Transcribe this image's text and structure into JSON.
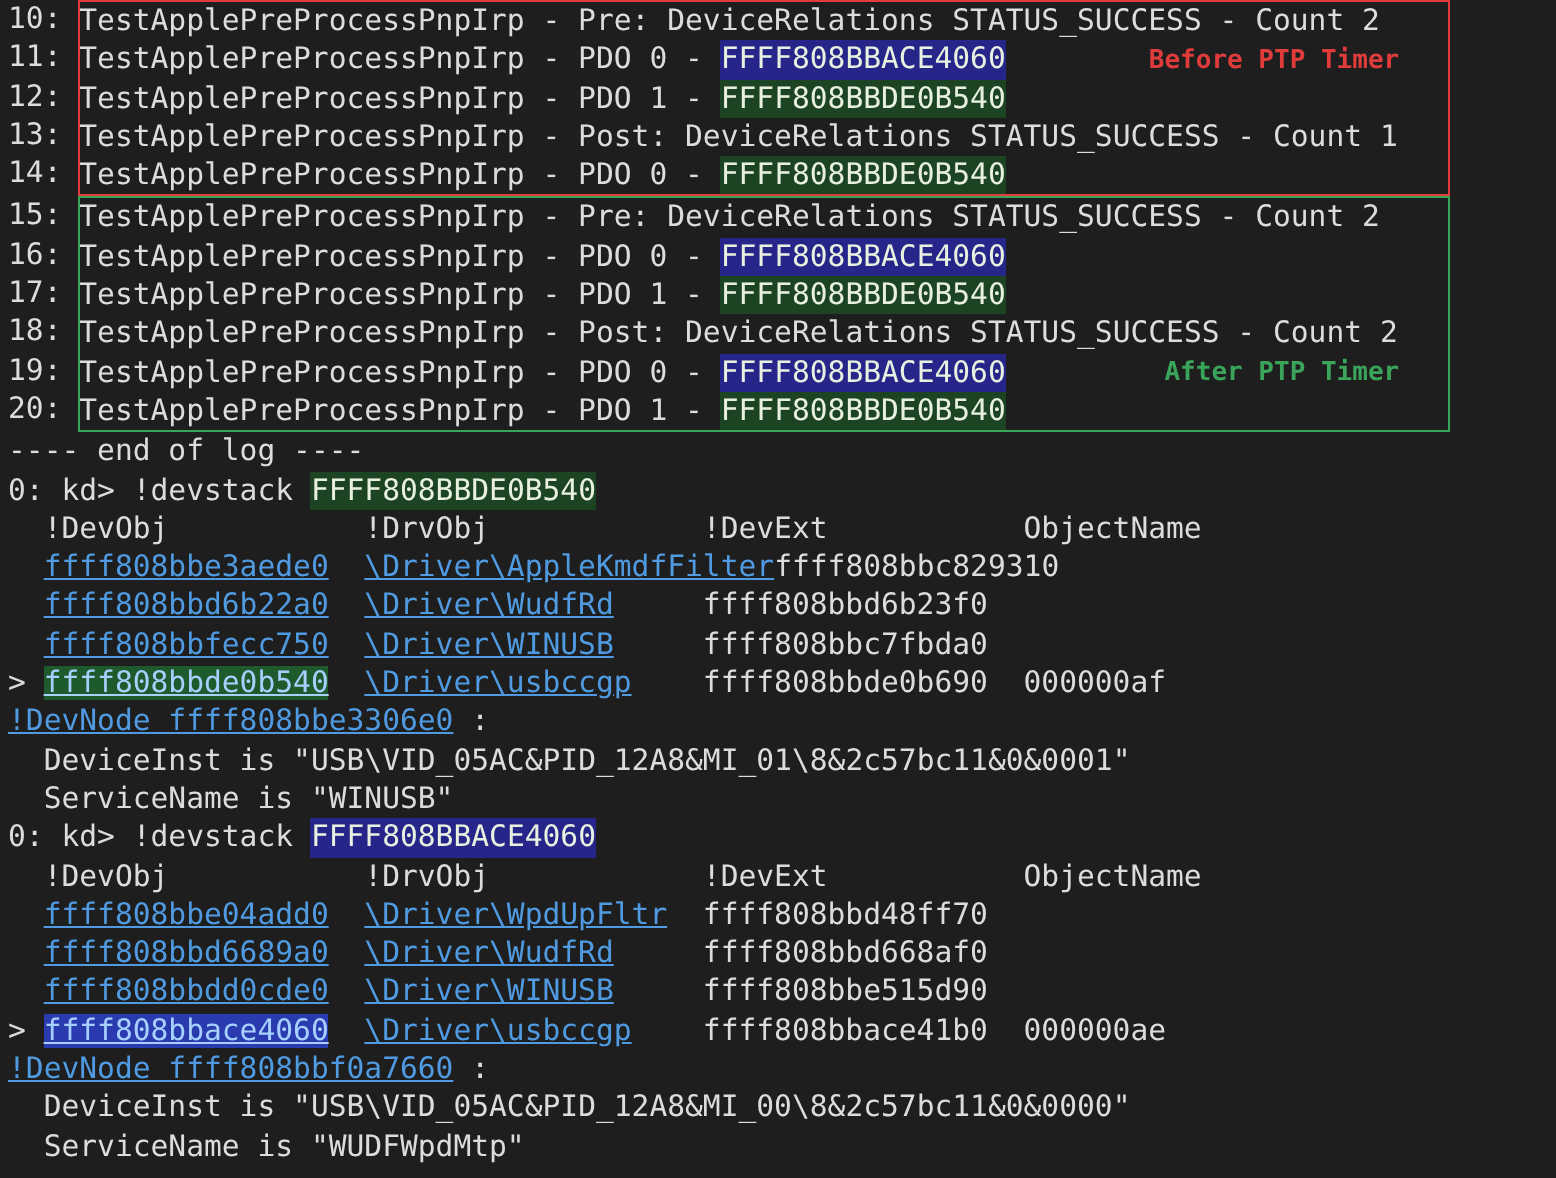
{
  "log_groups": [
    {
      "kind": "before",
      "label": "Before PTP Timer",
      "color": "#e03c3c",
      "lines": [
        {
          "number": "10:",
          "text": "TestApplePreProcessPnpIrp - Pre: DeviceRelations STATUS_SUCCESS - Count 2"
        },
        {
          "number": "11:",
          "text": "TestApplePreProcessPnpIrp - PDO 0 - ",
          "value": "FFFF808BBACE4060",
          "color": "#25258a"
        },
        {
          "number": "12:",
          "text": "TestApplePreProcessPnpIrp - PDO 1 - ",
          "value": "FFFF808BBDE0B540",
          "color": "#1c4422"
        },
        {
          "number": "13:",
          "text": "TestApplePreProcessPnpIrp - Post: DeviceRelations STATUS_SUCCESS - Count 1"
        },
        {
          "number": "14:",
          "text": "TestApplePreProcessPnpIrp - PDO 0 - ",
          "value": "FFFF808BBDE0B540",
          "color": "#1c4422"
        }
      ]
    },
    {
      "kind": "after",
      "label": "After PTP Timer",
      "color": "#3aa55a",
      "lines": [
        {
          "number": "15:",
          "text": "TestApplePreProcessPnpIrp - Pre: DeviceRelations STATUS_SUCCESS - Count 2"
        },
        {
          "number": "16:",
          "text": "TestApplePreProcessPnpIrp - PDO 0 - ",
          "value": "FFFF808BBACE4060",
          "color": "#25258a"
        },
        {
          "number": "17:",
          "text": "TestApplePreProcessPnpIrp - PDO 1 - ",
          "value": "FFFF808BBDE0B540",
          "color": "#1c4422"
        },
        {
          "number": "18:",
          "text": "TestApplePreProcessPnpIrp - Post: DeviceRelations STATUS_SUCCESS - Count 2"
        },
        {
          "number": "19:",
          "text": "TestApplePreProcessPnpIrp - PDO 0 - ",
          "value": "FFFF808BBACE4060",
          "color": "#25258a"
        },
        {
          "number": "20:",
          "text": "TestApplePreProcessPnpIrp - PDO 1 - ",
          "value": "FFFF808BBDE0B540",
          "color": "#1c4422"
        }
      ]
    }
  ],
  "end_of_log": "---- end of log ----",
  "devstacks": [
    {
      "prompt": "0: kd> !devstack",
      "address": "FFFF808BBDE0B540",
      "color": "#1c4422",
      "columns": [
        "!DevObj",
        "!DrvObj",
        "!DevExt",
        "ObjectName"
      ],
      "rows": [
        {
          "selected": false,
          "devobj": "ffff808bbe3aede0",
          "drvobj": "\\Driver\\AppleKmdfFilter",
          "devext": "ffff808bbc829310"
        },
        {
          "selected": false,
          "devobj": "ffff808bbd6b22a0",
          "drvobj": "\\Driver\\WudfRd",
          "devext": "ffff808bbd6b23f0"
        },
        {
          "selected": false,
          "devobj": "ffff808bbfecc750",
          "drvobj": "\\Driver\\WINUSB",
          "devext": "ffff808bbc7fbda0"
        },
        {
          "selected": true,
          "marker": ">",
          "color": "#1d5a2c",
          "devobj": "ffff808bbde0b540",
          "drvobj": "\\Driver\\usbccgp",
          "devext": "ffff808bbde0b690",
          "object_name": "000000af"
        }
      ],
      "devnode_link": "!DevNode ffff808bbe3306e0",
      "devnode_suffix": ":",
      "details": [
        "DeviceInst is \"USB\\VID_05AC&PID_12A8&MI_01\\8&2c57bc11&0&0001\"",
        "ServiceName is \"WINUSB\""
      ]
    },
    {
      "prompt": "0: kd> !devstack",
      "address": "FFFF808BBACE4060",
      "color": "#25258a",
      "columns": [
        "!DevObj",
        "!DrvObj",
        "!DevExt",
        "ObjectName"
      ],
      "rows": [
        {
          "selected": false,
          "devobj": "ffff808bbe04add0",
          "drvobj": "\\Driver\\WpdUpFltr",
          "devext": "ffff808bbd48ff70"
        },
        {
          "selected": false,
          "devobj": "ffff808bbd6689a0",
          "drvobj": "\\Driver\\WudfRd",
          "devext": "ffff808bbd668af0"
        },
        {
          "selected": false,
          "devobj": "ffff808bbdd0cde0",
          "drvobj": "\\Driver\\WINUSB",
          "devext": "ffff808bbe515d90"
        },
        {
          "selected": true,
          "marker": ">",
          "color": "#2a3bb0",
          "devobj": "ffff808bbace4060",
          "drvobj": "\\Driver\\usbccgp",
          "devext": "ffff808bbace41b0",
          "object_name": "000000ae"
        }
      ],
      "devnode_link": "!DevNode ffff808bbf0a7660",
      "devnode_suffix": ":",
      "details": [
        "DeviceInst is \"USB\\VID_05AC&PID_12A8&MI_00\\8&2c57bc11&0&0000\"",
        "ServiceName is \"WUDFWpdMtp\""
      ]
    }
  ]
}
